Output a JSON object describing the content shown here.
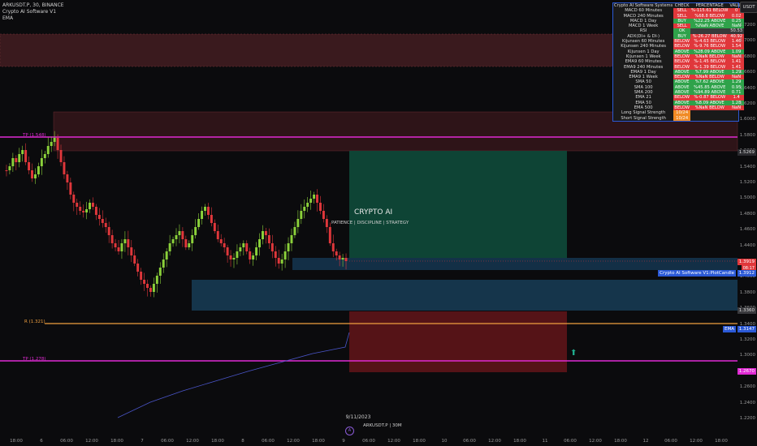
{
  "header": {
    "symbol_line": "ARKUSDT.P, 30, BINANCE",
    "indicator1": "Crypto AI Software V1",
    "indicator2": "EMA"
  },
  "currency_button": "USDT",
  "watermark": {
    "title": "CRYPTO AI",
    "tagline": "PATIENCE  |  DISCIPLINE  |  STRATEGY"
  },
  "table": {
    "headers": [
      "Crypto AI Software Systems",
      "CHECK",
      "PERCENTAGE",
      "VALUE"
    ],
    "rows": [
      {
        "name": "MACD 60 Minutes",
        "check": "SELL",
        "pct": "%-115.61 BELOW",
        "val": "0",
        "cc": "sell",
        "pc": "below"
      },
      {
        "name": "MACD 240 Minutes",
        "check": "SELL",
        "pct": "%68.8 BELOW",
        "val": "0.02",
        "cc": "sell",
        "pc": "below"
      },
      {
        "name": "MACD 1 Day",
        "check": "BUY",
        "pct": "%22.25 ABOVE",
        "val": "0.25",
        "cc": "buy",
        "pc": "above"
      },
      {
        "name": "MACD 1 Week",
        "check": "SELL",
        "pct": "%NaN ABOVE",
        "val": "NaN",
        "cc": "sell",
        "pc": "above"
      },
      {
        "name": "RSI",
        "check": "OK",
        "pct": "",
        "val": "50.53",
        "cc": "ok",
        "pc": "nan"
      },
      {
        "name": "ADX(DI+ & DI-)",
        "check": "BUY",
        "pct": "%-26.27 BELOW",
        "val": "40.92",
        "cc": "buy",
        "pc": "below"
      },
      {
        "name": "Kijunsen 60 Minutes",
        "check": "BELOW",
        "pct": "%-4.63 BELOW",
        "val": "1.46",
        "cc": "below",
        "pc": "below"
      },
      {
        "name": "Kijunsen 240 Minutes",
        "check": "BELOW",
        "pct": "%-9.76 BELOW",
        "val": "1.54",
        "cc": "below",
        "pc": "below"
      },
      {
        "name": "Kijunsen 1 Day",
        "check": "ABOVE",
        "pct": "%28.09 ABOVE",
        "val": "1.09",
        "cc": "above",
        "pc": "above"
      },
      {
        "name": "Kijunsen 1 Week",
        "check": "BELOW",
        "pct": "%NaN BELOW",
        "val": "NaN",
        "cc": "below",
        "pc": "below"
      },
      {
        "name": "EMA9 60 Minutes",
        "check": "BELOW",
        "pct": "%-1.45 BELOW",
        "val": "1.41",
        "cc": "below",
        "pc": "below"
      },
      {
        "name": "EMA9 240 Minutes",
        "check": "BELOW",
        "pct": "%-1.39 BELOW",
        "val": "1.41",
        "cc": "below",
        "pc": "below"
      },
      {
        "name": "EMA9 1 Day",
        "check": "ABOVE",
        "pct": "%7.99 ABOVE",
        "val": "1.29",
        "cc": "above",
        "pc": "above"
      },
      {
        "name": "EMA9 1 Week",
        "check": "BELOW",
        "pct": "%NaN BELOW",
        "val": "NaN",
        "cc": "below",
        "pc": "below"
      },
      {
        "name": "SMA 50",
        "check": "ABOVE",
        "pct": "%7.62 ABOVE",
        "val": "1.29",
        "cc": "above",
        "pc": "above"
      },
      {
        "name": "SMA 100",
        "check": "ABOVE",
        "pct": "%45.85 ABOVE",
        "val": "0.95",
        "cc": "above",
        "pc": "above"
      },
      {
        "name": "SMA 200",
        "check": "ABOVE",
        "pct": "%94.89 ABOVE",
        "val": "0.71",
        "cc": "above",
        "pc": "above"
      },
      {
        "name": "EMA 21",
        "check": "BELOW",
        "pct": "%-0.87 BELOW",
        "val": "1.4",
        "cc": "below",
        "pc": "below"
      },
      {
        "name": "EMA 50",
        "check": "ABOVE",
        "pct": "%8.09 ABOVE",
        "val": "1.28",
        "cc": "above",
        "pc": "above"
      },
      {
        "name": "EMA 500",
        "check": "BELOW",
        "pct": "%NaN BELOW",
        "val": "NaN",
        "cc": "below",
        "pc": "below"
      },
      {
        "name": "Long Signal Strength",
        "check": "10/24",
        "pct": "",
        "val": "",
        "cc": "orange",
        "pc": "none"
      },
      {
        "name": "Short Signal Strength",
        "check": "10/24",
        "pct": "",
        "val": "",
        "cc": "orange",
        "pc": "none"
      }
    ]
  },
  "price_axis": {
    "ticks": [
      "1.7200",
      "1.7000",
      "1.6800",
      "1.6600",
      "1.6400",
      "1.6200",
      "1.6000",
      "1.5800",
      "1.5600",
      "1.5400",
      "1.5200",
      "1.5000",
      "1.4800",
      "1.4600",
      "1.4400",
      "1.4200",
      "1.4000",
      "1.3800",
      "1.3600",
      "1.3400",
      "1.3200",
      "1.3000",
      "1.2800",
      "1.2600",
      "1.2400",
      "1.2200"
    ],
    "tags": {
      "top_gray": "1.5269",
      "last_price": "1.3919",
      "countdown": "08:17",
      "plot_candle_label": "Crypto AI Software V1:PlotCandle",
      "plot_candle_value": "1.3912",
      "lower_gray": "1.3360",
      "ema_label": "EMA",
      "ema_value": "1.3147",
      "bottom_pink": "1.2670"
    }
  },
  "hlines": {
    "pink_top_label": "TP (1.548)",
    "orange_label": "R (1.321)",
    "pink_bottom_label": "TP (1.278)"
  },
  "time_axis": [
    "18:00",
    "6",
    "06:00",
    "12:00",
    "18:00",
    "7",
    "06:00",
    "12:00",
    "18:00",
    "8",
    "06:00",
    "12:00",
    "18:00",
    "9",
    "06:00",
    "12:00",
    "18:00",
    "10",
    "06:00",
    "12:00",
    "18:00",
    "11",
    "06:00",
    "12:00",
    "18:00",
    "12",
    "06:00",
    "12:00",
    "18:00"
  ],
  "bottom": {
    "date": "9/11/2023",
    "symbol": "ARKUSDT.P | 30M",
    "marker": "A"
  },
  "colors": {
    "background": "#0b0b0d",
    "bull": "#8bd13a",
    "bear": "#e0373b",
    "pink_line": "#e02ad3",
    "orange_line": "#f0a040",
    "long_zone": "#0f4a3a",
    "short_zone": "#5a1418",
    "blue_zone": "#1a3b55",
    "table_border": "#2b59d6"
  }
}
